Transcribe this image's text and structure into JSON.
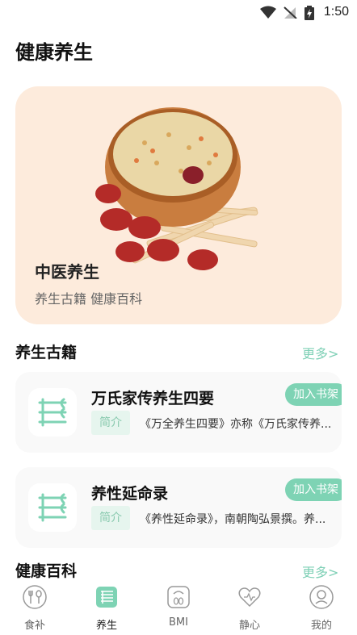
{
  "status_bar": {
    "time": "1:50"
  },
  "page_title": "健康养生",
  "hero": {
    "title": "中医养生",
    "subtitle": "养生古籍 健康百科"
  },
  "sections": {
    "ancient_books": {
      "title": "养生古籍",
      "more": "更多>"
    },
    "encyclopedia": {
      "title": "健康百科",
      "more": "更多>"
    }
  },
  "books": [
    {
      "title": "万氏家传养生四要",
      "tag": "简介",
      "desc": "《万全养生四要》亦称《万氏家传养...",
      "action": "加入书架"
    },
    {
      "title": "养性延命录",
      "tag": "简介",
      "desc": "《养性延命录》，南朝陶弘景撰。养...",
      "action": "加入书架"
    }
  ],
  "tabbar": [
    {
      "label": "食补"
    },
    {
      "label": "养生"
    },
    {
      "label": "BMI"
    },
    {
      "label": "静心"
    },
    {
      "label": "我的"
    }
  ],
  "colors": {
    "accent": "#7ed3b4",
    "hero_bg": "#fdebdc",
    "card_bg": "#f9f9f9"
  }
}
